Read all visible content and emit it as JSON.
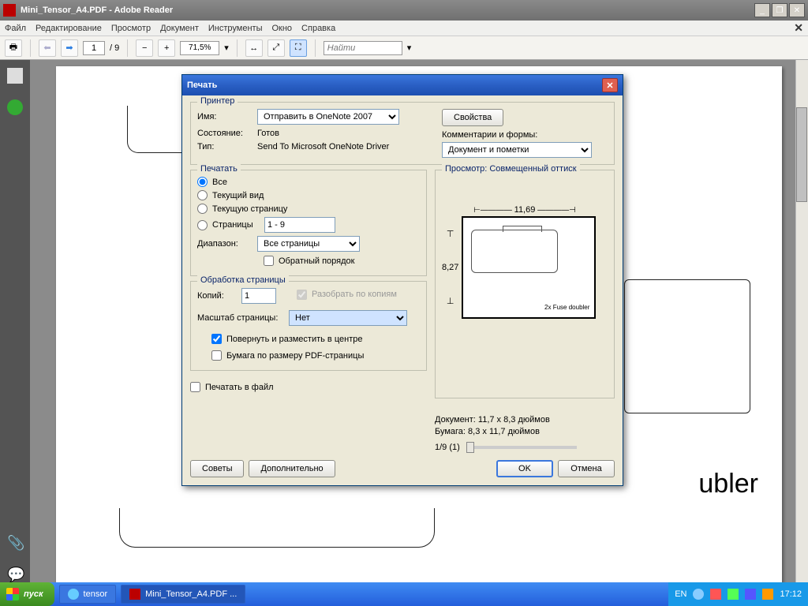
{
  "app": {
    "title": "Mini_Tensor_A4.PDF - Adobe Reader"
  },
  "menu": [
    "Файл",
    "Редактирование",
    "Просмотр",
    "Документ",
    "Инструменты",
    "Окно",
    "Справка"
  ],
  "toolbar": {
    "page": "1",
    "total_pages": "/ 9",
    "zoom": "71,5%",
    "find_placeholder": "Найти"
  },
  "page": {
    "doubler_text": "ubler"
  },
  "dialog": {
    "title": "Печать",
    "printer": {
      "group": "Принтер",
      "name_lbl": "Имя:",
      "name_val": "Отправить в OneNote 2007",
      "properties": "Свойства",
      "status_lbl": "Состояние:",
      "status_val": "Готов",
      "type_lbl": "Тип:",
      "type_val": "Send To Microsoft OneNote Driver",
      "comments_lbl": "Комментарии и формы:",
      "comments_val": "Документ и пометки"
    },
    "range": {
      "group": "Печатать",
      "all": "Все",
      "current_view": "Текущий вид",
      "current_page": "Текущую страницу",
      "pages_lbl": "Страницы",
      "pages_val": "1 - 9",
      "subset_lbl": "Диапазон:",
      "subset_val": "Все страницы",
      "reverse": "Обратный порядок"
    },
    "handling": {
      "group": "Обработка страницы",
      "copies_lbl": "Копий:",
      "copies_val": "1",
      "collate": "Разобрать по копиям",
      "scale_lbl": "Масштаб страницы:",
      "scale_val": "Нет",
      "autorotate": "Повернуть и разместить в центре",
      "choose_paper": "Бумага по размеру PDF-страницы"
    },
    "print_to_file": "Печатать в файл",
    "preview": {
      "title": "Просмотр: Совмещенный оттиск",
      "width": "11,69",
      "height": "8,27",
      "label": "2x Fuse doubler",
      "doc_info": "Документ: 11,7 x 8,3 дюймов",
      "paper_info": "Бумага: 8,3 x 11,7 дюймов",
      "counter": "1/9 (1)"
    },
    "buttons": {
      "tips": "Советы",
      "advanced": "Дополнительно",
      "ok": "OK",
      "cancel": "Отмена"
    }
  },
  "taskbar": {
    "start": "пуск",
    "tasks": [
      {
        "label": "tensor"
      },
      {
        "label": "Mini_Tensor_A4.PDF ..."
      }
    ],
    "lang": "EN",
    "time": "17:12"
  }
}
